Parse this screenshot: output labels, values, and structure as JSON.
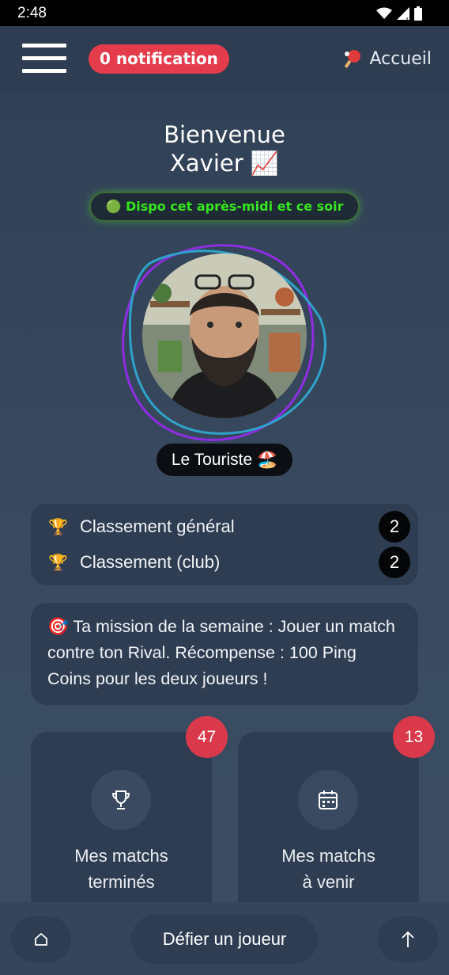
{
  "status_bar": {
    "time": "2:48"
  },
  "header": {
    "notification_label": "0 notification",
    "home_icon": "ping-pong-paddle",
    "home_label": "Accueil"
  },
  "welcome": {
    "line1": "Bienvenue",
    "line2": "Xavier 📈"
  },
  "availability": "🟢 Dispo cet après-midi et ce soir",
  "profile": {
    "title": "Le Touriste 🏖️"
  },
  "rankings": [
    {
      "icon": "🏆",
      "label": "Classement général",
      "value": "2"
    },
    {
      "icon": "🏆",
      "label": "Classement (club)",
      "value": "2"
    }
  ],
  "mission": "🎯 Ta mission de la semaine : Jouer un match contre ton Rival. Récompense : 100 Ping Coins pour les deux joueurs !",
  "matches": {
    "finished": {
      "count": "47",
      "label_line1": "Mes matchs",
      "label_line2": "terminés",
      "icon": "trophy-icon"
    },
    "upcoming": {
      "count": "13",
      "label_line1": "Mes matchs",
      "label_line2": "à venir",
      "icon": "calendar-icon"
    }
  },
  "bottom_bar": {
    "challenge_label": "Défier un joueur"
  },
  "colors": {
    "background": "#2f3f54",
    "card": "#2f3d52",
    "badge_red": "#e43c4b",
    "dispo_green": "#35e51d",
    "ring_purple": "#8e2de2",
    "ring_teal": "#2ea3c9"
  }
}
